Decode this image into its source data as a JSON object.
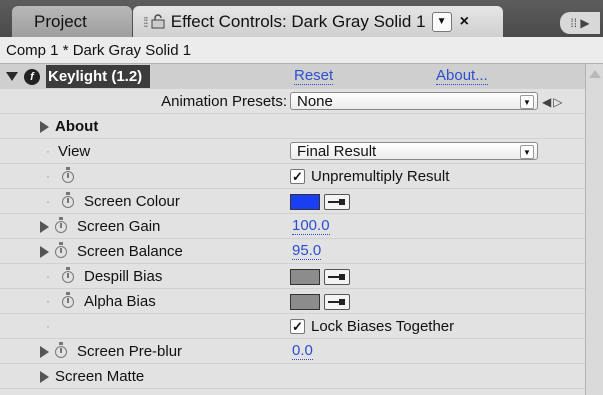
{
  "tabs": {
    "project": "Project",
    "effect_controls": "Effect Controls: Dark Gray Solid 1"
  },
  "comp_line": "Comp 1 * Dark Gray Solid 1",
  "effect": {
    "name": "Keylight (1.2)",
    "reset": "Reset",
    "about": "About...",
    "presets_label": "Animation Presets:",
    "presets_value": "None"
  },
  "rows": {
    "about": "About",
    "view_label": "View",
    "view_value": "Final Result",
    "unpremultiply": "Unpremultiply Result",
    "screen_colour": "Screen Colour",
    "screen_gain": "Screen Gain",
    "screen_gain_value": "100.0",
    "screen_balance": "Screen Balance",
    "screen_balance_value": "95.0",
    "despill_bias": "Despill Bias",
    "alpha_bias": "Alpha Bias",
    "lock_biases": "Lock Biases Together",
    "screen_preblur": "Screen Pre-blur",
    "screen_preblur_value": "0.0",
    "screen_matte": "Screen Matte"
  },
  "colors": {
    "screen_colour_swatch": "#1a3ff2",
    "bias_swatch": "#8c8c8c",
    "link_blue": "#2b4fd0"
  },
  "states": {
    "unpremultiply_checked": true,
    "lock_biases_checked": true
  }
}
